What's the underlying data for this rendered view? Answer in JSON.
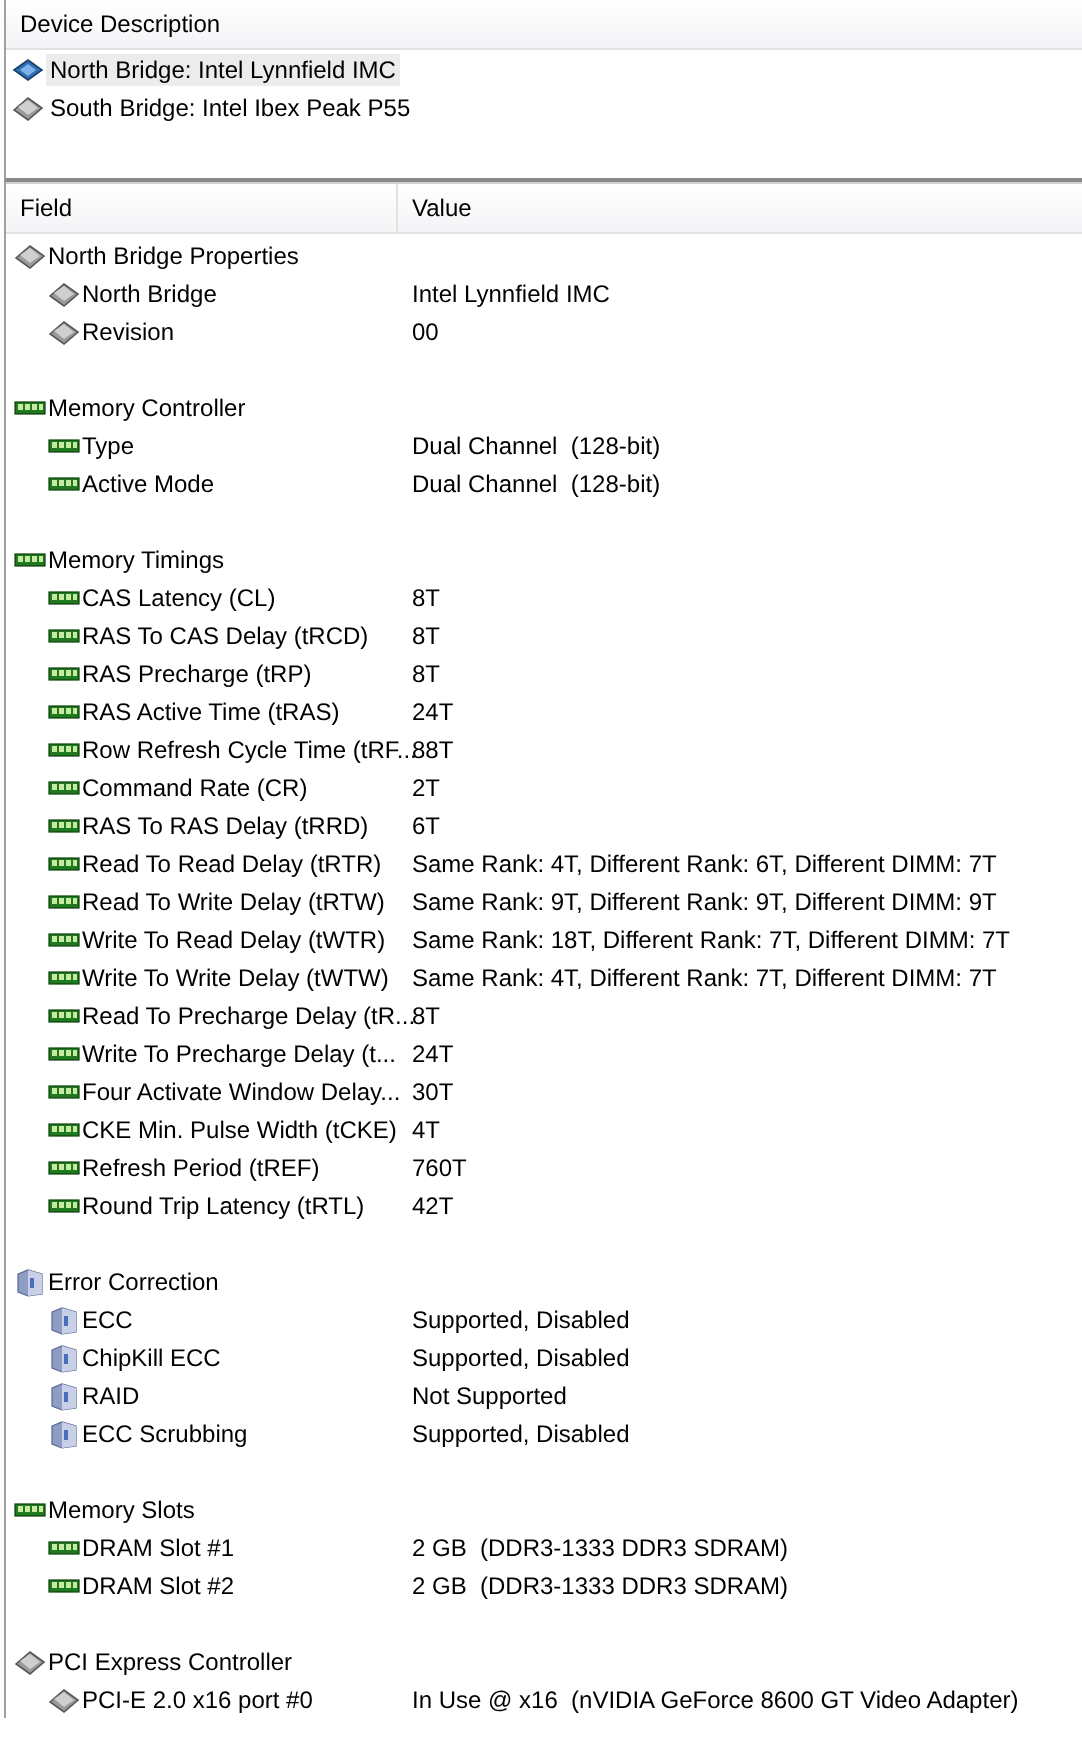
{
  "devices": {
    "header": "Device Description",
    "items": [
      {
        "label": "North Bridge: Intel Lynnfield IMC",
        "kind": "bridge",
        "selected": true
      },
      {
        "label": "South Bridge: Intel Ibex Peak P55",
        "kind": "chip",
        "selected": false
      }
    ]
  },
  "table": {
    "columns": [
      "Field",
      "Value"
    ],
    "sections": [
      {
        "title": "North Bridge Properties",
        "kind": "chip",
        "rows": [
          {
            "field": "North Bridge",
            "value": "Intel Lynnfield IMC"
          },
          {
            "field": "Revision",
            "value": "00"
          }
        ]
      },
      {
        "title": "Memory Controller",
        "kind": "memory",
        "rows": [
          {
            "field": "Type",
            "value": "Dual Channel  (128-bit)"
          },
          {
            "field": "Active Mode",
            "value": "Dual Channel  (128-bit)"
          }
        ]
      },
      {
        "title": "Memory Timings",
        "kind": "memory",
        "rows": [
          {
            "field": "CAS Latency (CL)",
            "value": "8T"
          },
          {
            "field": "RAS To CAS Delay (tRCD)",
            "value": "8T"
          },
          {
            "field": "RAS Precharge (tRP)",
            "value": "8T"
          },
          {
            "field": "RAS Active Time (tRAS)",
            "value": "24T"
          },
          {
            "field": "Row Refresh Cycle Time (tRF...",
            "value": "88T"
          },
          {
            "field": "Command Rate (CR)",
            "value": "2T"
          },
          {
            "field": "RAS To RAS Delay (tRRD)",
            "value": "6T"
          },
          {
            "field": "Read To Read Delay (tRTR)",
            "value": "Same Rank: 4T, Different Rank: 6T, Different DIMM: 7T"
          },
          {
            "field": "Read To Write Delay (tRTW)",
            "value": "Same Rank: 9T, Different Rank: 9T, Different DIMM: 9T"
          },
          {
            "field": "Write To Read Delay (tWTR)",
            "value": "Same Rank: 18T, Different Rank: 7T, Different DIMM: 7T"
          },
          {
            "field": "Write To Write Delay (tWTW)",
            "value": "Same Rank: 4T, Different Rank: 7T, Different DIMM: 7T"
          },
          {
            "field": "Read To Precharge Delay (tR...",
            "value": "8T"
          },
          {
            "field": "Write To Precharge Delay (t...",
            "value": "24T"
          },
          {
            "field": "Four Activate Window Delay...",
            "value": "30T"
          },
          {
            "field": "CKE Min. Pulse Width (tCKE)",
            "value": "4T"
          },
          {
            "field": "Refresh Period (tREF)",
            "value": "760T"
          },
          {
            "field": "Round Trip Latency (tRTL)",
            "value": "42T"
          }
        ]
      },
      {
        "title": "Error Correction",
        "kind": "cube",
        "rows": [
          {
            "field": "ECC",
            "value": "Supported, Disabled"
          },
          {
            "field": "ChipKill ECC",
            "value": "Supported, Disabled"
          },
          {
            "field": "RAID",
            "value": "Not Supported"
          },
          {
            "field": "ECC Scrubbing",
            "value": "Supported, Disabled"
          }
        ]
      },
      {
        "title": "Memory Slots",
        "kind": "memory",
        "rows": [
          {
            "field": "DRAM Slot #1",
            "value": "2 GB  (DDR3-1333 DDR3 SDRAM)"
          },
          {
            "field": "DRAM Slot #2",
            "value": "2 GB  (DDR3-1333 DDR3 SDRAM)"
          }
        ]
      },
      {
        "title": "PCI Express Controller",
        "kind": "chip",
        "rows": [
          {
            "field": "PCI-E 2.0 x16 port #0",
            "value": "In Use @ x16  (nVIDIA GeForce 8600 GT Video Adapter)"
          }
        ]
      }
    ]
  }
}
